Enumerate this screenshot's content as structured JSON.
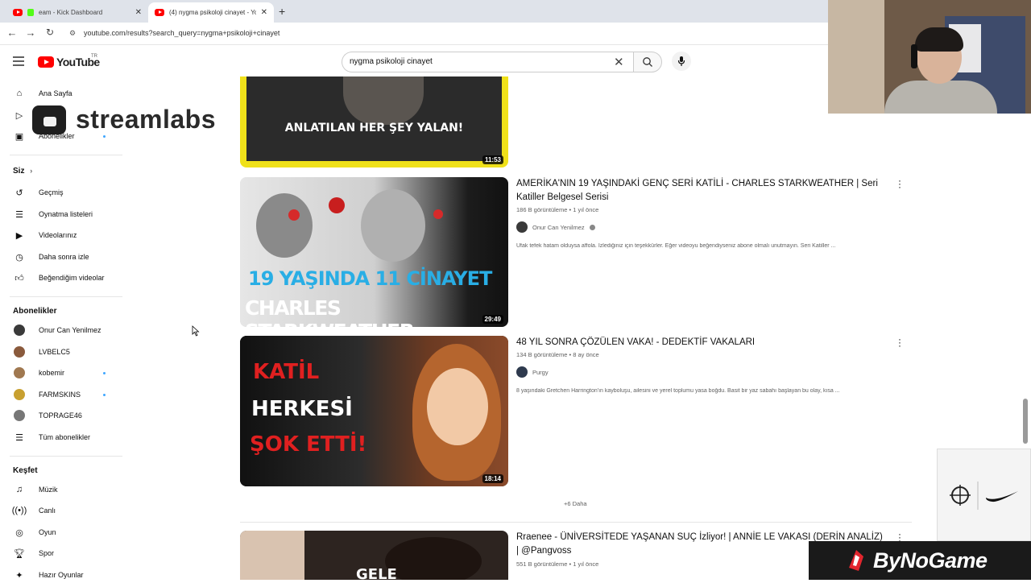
{
  "browser": {
    "tabs": [
      {
        "label": "eam - Kick Dashboard",
        "active": false
      },
      {
        "label": "(4) nygma psikoloji cinayet - Yo",
        "active": true
      }
    ],
    "url": "youtube.com/results?search_query=nygma+psikoloji+cinayet"
  },
  "header": {
    "logo": "YouTube",
    "logo_region": "TR",
    "search_value": "nygma psikoloji cinayet"
  },
  "overlay": {
    "streamlabs": "streamlabs",
    "sponsor": "ByNoGame"
  },
  "sidebar": {
    "main": [
      {
        "label": "Ana Sayfa",
        "icon": "home-icon"
      },
      {
        "label": "Shorts",
        "icon": "shorts-icon"
      },
      {
        "label": "Abonelikler",
        "icon": "subscriptions-icon",
        "dot": true
      }
    ],
    "you_header": "Siz",
    "you": [
      {
        "label": "Geçmiş",
        "icon": "history-icon"
      },
      {
        "label": "Oynatma listeleri",
        "icon": "playlists-icon"
      },
      {
        "label": "Videolarınız",
        "icon": "your-videos-icon"
      },
      {
        "label": "Daha sonra izle",
        "icon": "watch-later-icon"
      },
      {
        "label": "Beğendiğim videolar",
        "icon": "liked-icon"
      }
    ],
    "subs_header": "Abonelikler",
    "subs": [
      {
        "label": "Onur Can Yenilmez",
        "color": "#3a3a3a",
        "dot": false
      },
      {
        "label": "LVBELC5",
        "color": "#8a5a3c",
        "dot": false
      },
      {
        "label": "kobemir",
        "color": "#a07850",
        "dot": true
      },
      {
        "label": "FARMSKINS",
        "color": "#c8a030",
        "dot": true
      },
      {
        "label": "TOPRAGE46",
        "color": "#777777",
        "dot": false
      },
      {
        "label": "Tüm abonelikler",
        "icon": "list-icon",
        "dot": false
      }
    ],
    "explore_header": "Keşfet",
    "explore": [
      {
        "label": "Müzik",
        "icon": "music-icon"
      },
      {
        "label": "Canlı",
        "icon": "live-icon"
      },
      {
        "label": "Oyun",
        "icon": "gaming-icon"
      },
      {
        "label": "Spor",
        "icon": "sports-icon"
      },
      {
        "label": "Hazır Oyunlar",
        "icon": "playables-icon"
      }
    ]
  },
  "videos": [
    {
      "thumb_text": "ANLATILAN HER ŞEY YALAN!",
      "duration": "11:53"
    },
    {
      "title": "AMERİKA'NIN 19 YAŞINDAKİ GENÇ SERİ KATİLİ - CHARLES STARKWEATHER | Seri Katiller Belgesel Serisi",
      "views": "186 B görüntüleme",
      "age": "1 yıl önce",
      "channel": "Onur Can Yenilmez",
      "verified": true,
      "desc": "Ufak tefek hatam olduysa affola. İzlediğiniz için teşekkürler. Eğer videoyu beğendiyseniz abone olmalı unutmayın. Seri Katiller ...",
      "thumb_line1": "19 YAŞINDA 11 CİNAYET",
      "thumb_line2": "CHARLES STARKWEATHER",
      "duration": "29:49"
    },
    {
      "title": "48 YIL SONRA ÇÖZÜLEN VAKA! - DEDEKTİF VAKALARI",
      "views": "134 B görüntüleme",
      "age": "8 ay önce",
      "channel": "Purgy",
      "verified": false,
      "desc": "8 yaşındaki Gretchen Harrington'ın kayboluşu, ailesini ve yerel toplumu yasa boğdu. Basit bir yaz sabahı başlayan bu olay, kısa ...",
      "thumb_line1": "KATİL",
      "thumb_line2": "HERKESİ",
      "thumb_line3": "ŞOK ETTİ!",
      "duration": "18:14"
    },
    {
      "title": "Rraenee - ÜNİVERSİTEDE YAŞANAN SUÇ İzliyor! | ANNİE LE VAKASI (DERİN ANALİZ) | @Pangvoss",
      "views": "551 B görüntüleme",
      "age": "1 yıl önce",
      "thumb_text": "GELE"
    }
  ],
  "more_label": "+6 Daha"
}
